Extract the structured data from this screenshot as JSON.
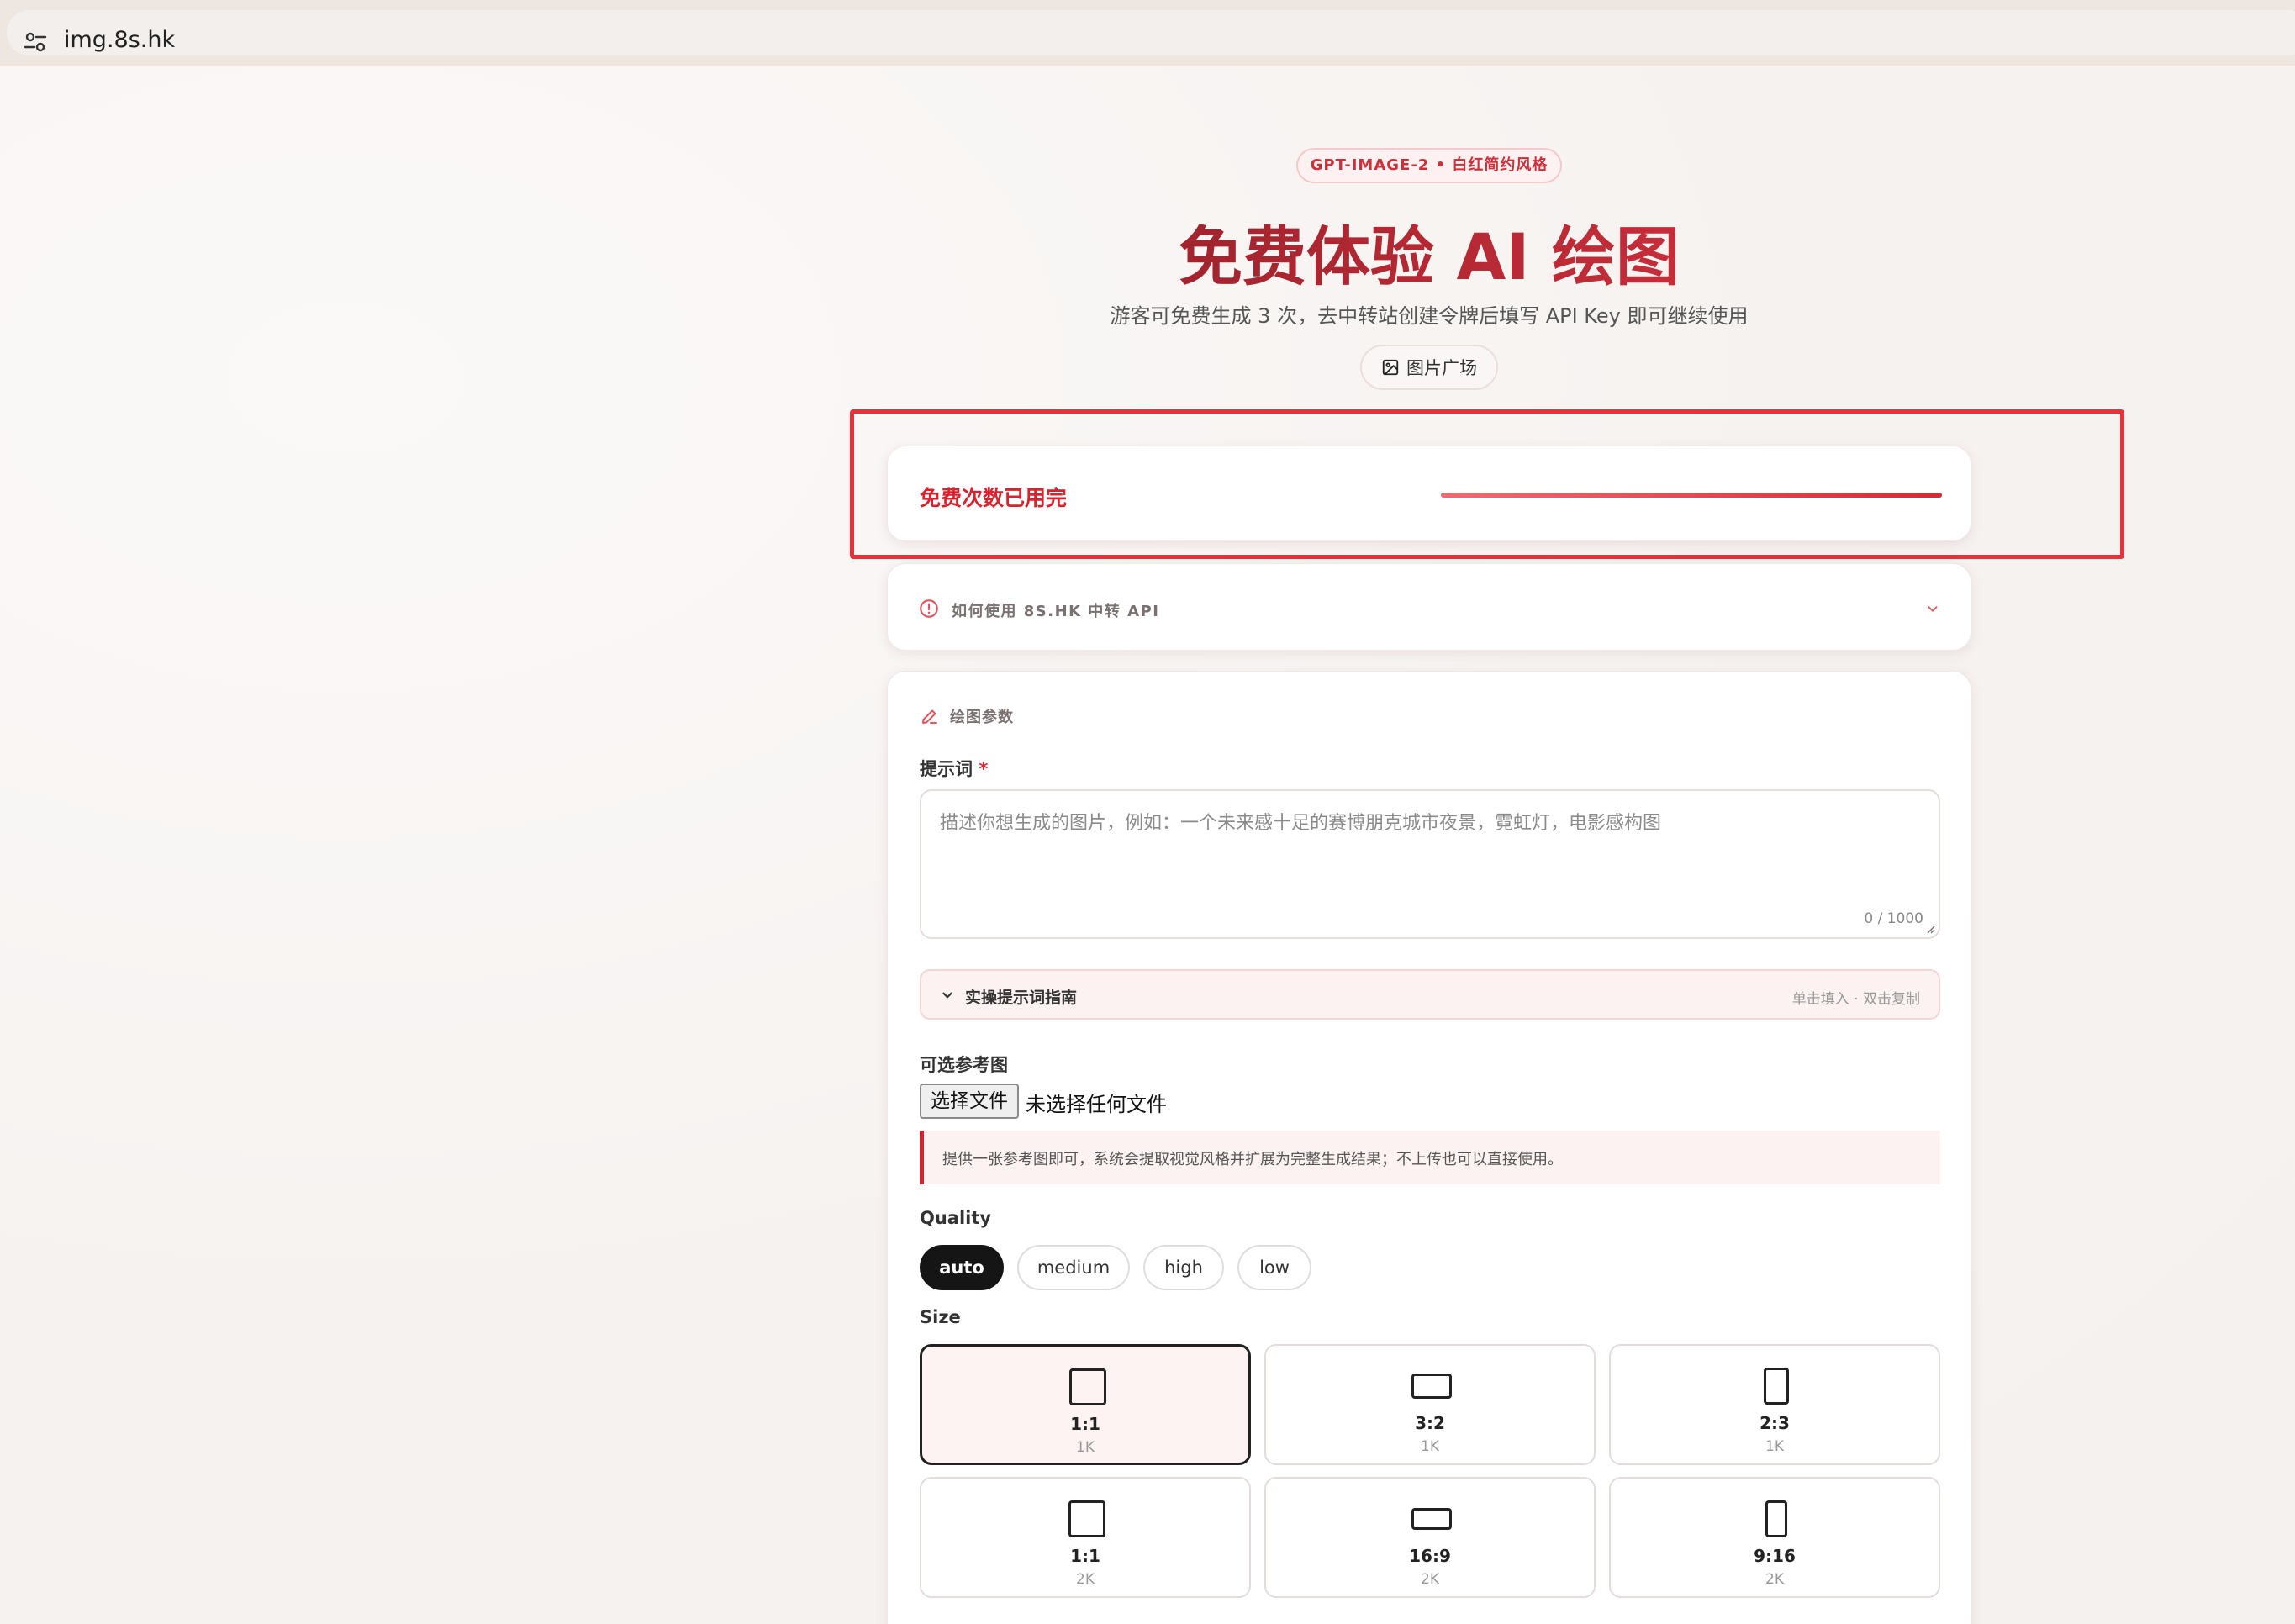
{
  "browser": {
    "url": "img.8s.hk"
  },
  "hero": {
    "badge": "GPT-IMAGE-2 • 白红简约风格",
    "title": "免费体验 AI 绘图",
    "subtitle": "游客可免费生成 3 次，去中转站创建令牌后填写 API Key 即可继续使用",
    "gallery_label": "图片广场"
  },
  "quota": {
    "status": "免费次数已用完",
    "used_fraction": 1.0
  },
  "howto": {
    "label": "如何使用 8S.HK 中转 API"
  },
  "params": {
    "section_title": "绘图参数",
    "prompt_label": "提示词",
    "required_mark": "*",
    "prompt_placeholder": "描述你想生成的图片，例如：一个未来感十足的赛博朋克城市夜景，霓虹灯，电影感构图",
    "prompt_counter": "0 / 1000",
    "guide_title": "实操提示词指南",
    "guide_hint": "单击填入 · 双击复制",
    "ref_label": "可选参考图",
    "file_button": "选择文件",
    "file_status": "未选择任何文件",
    "ref_tip": "提供一张参考图即可，系统会提取视觉风格并扩展为完整生成结果；不上传也可以直接使用。",
    "quality_label": "Quality",
    "quality_options": [
      "auto",
      "medium",
      "high",
      "low"
    ],
    "quality_selected": "auto",
    "size_label": "Size",
    "sizes": [
      {
        "ratio": "1:1",
        "res": "1K"
      },
      {
        "ratio": "3:2",
        "res": "1K"
      },
      {
        "ratio": "2:3",
        "res": "1K"
      },
      {
        "ratio": "1:1",
        "res": "2K"
      },
      {
        "ratio": "16:9",
        "res": "2K"
      },
      {
        "ratio": "9:16",
        "res": "2K"
      }
    ]
  },
  "colors": {
    "accent": "#d8232f",
    "highlight": "#e8313b",
    "dark": "#151515"
  }
}
